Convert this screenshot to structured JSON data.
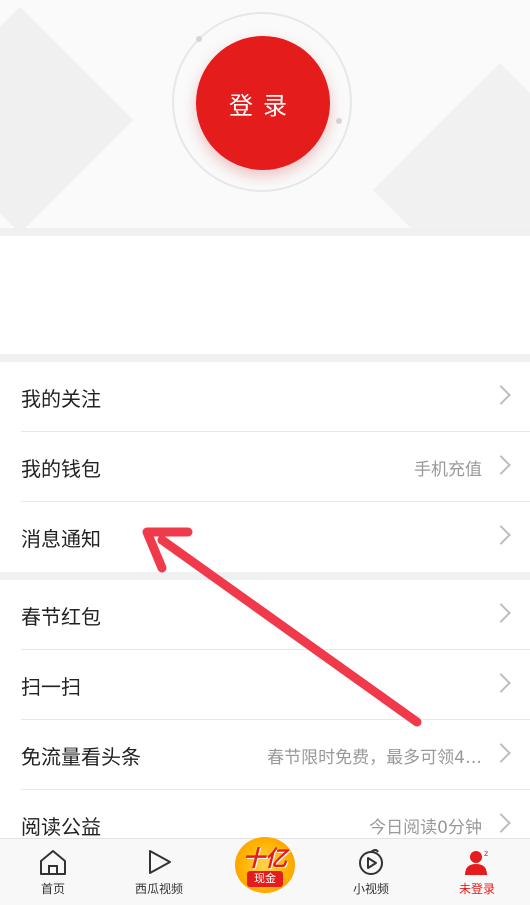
{
  "header": {
    "login_label": "登录"
  },
  "menu_groups": [
    [
      {
        "label": "我的关注",
        "hint": ""
      },
      {
        "label": "我的钱包",
        "hint": "手机充值"
      },
      {
        "label": "消息通知",
        "hint": ""
      }
    ],
    [
      {
        "label": "春节红包",
        "hint": ""
      },
      {
        "label": "扫一扫",
        "hint": ""
      },
      {
        "label": "免流量看头条",
        "hint": "春节限时免费，最多可领4…"
      },
      {
        "label": "阅读公益",
        "hint": "今日阅读0分钟"
      }
    ]
  ],
  "tabbar": {
    "home": "首页",
    "xigua": "西瓜视频",
    "promo_big": "十亿",
    "promo_small": "现金",
    "short_video": "小视频",
    "not_logged": "未登录"
  },
  "colors": {
    "accent": "#e41c1c",
    "annotation_arrow": "#f0394a"
  },
  "icons": {
    "chevron": "chevron-right-icon",
    "home": "home-icon",
    "xigua": "play-icon",
    "short_video": "video-icon",
    "profile": "user-icon"
  }
}
